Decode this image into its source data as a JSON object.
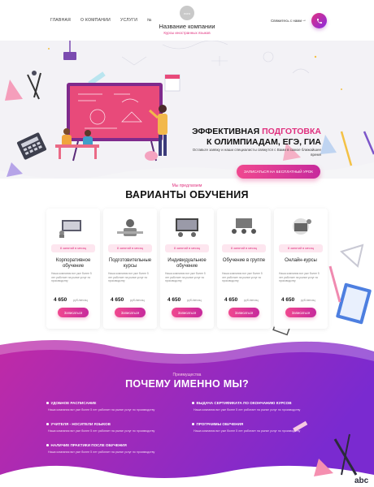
{
  "header": {
    "nav": [
      "Главная",
      "О компании",
      "Услуги",
      "№"
    ],
    "logo_text": "лого",
    "brand_title": "Название компании",
    "brand_subtitle": "Курсы иностранных языков",
    "callback_label": "Свяжитесь с нами",
    "phone_icon": "phone-icon"
  },
  "hero": {
    "title_part1": "ЭФФЕКТИВНАЯ ",
    "title_highlight": "ПОДГОТОВКА",
    "title_part2": "К ОЛИМПИАДАМ, ЕГЭ, ГИА",
    "subtitle": "Оставьте заявку и наши специалисты свяжутся с Вами в самое ближайшее время",
    "cta": "ЗАПИСАТЬСЯ НА БЕСПЛАТНЫЙ УРОК"
  },
  "courses": {
    "kicker": "Мы предлагаем",
    "title": "ВАРИАНТЫ ОБУЧЕНИЯ",
    "items": [
      {
        "badge": "8 занятий в месяц",
        "title": "Корпоративное обучение",
        "desc": "Наша компания вот уже более 5 лет работает на рынке услуг по производству",
        "price": "4 650",
        "unit": "руб./месяц",
        "button": "Записаться"
      },
      {
        "badge": "8 занятий в месяц",
        "title": "Подготовительные курсы",
        "desc": "Наша компания вот уже более 5 лет работает на рынке услуг по производству",
        "price": "4 650",
        "unit": "руб./месяц",
        "button": "Записаться"
      },
      {
        "badge": "8 занятий в месяц",
        "title": "Индивидуальное обучение",
        "desc": "Наша компания вот уже более 5 лет работает на рынке услуг по производству",
        "price": "4 650",
        "unit": "руб./месяц",
        "button": "Записаться"
      },
      {
        "badge": "8 занятий в месяц",
        "title": "Обучение в группе",
        "desc": "Наша компания вот уже более 5 лет работает на рынке услуг по производству",
        "price": "4 650",
        "unit": "руб./месяц",
        "button": "Записаться"
      },
      {
        "badge": "8 занятий в месяц",
        "title": "Онлайн-курсы",
        "desc": "Наша компания вот уже более 5 лет работает на рынке услуг по производству",
        "price": "4 650",
        "unit": "руб./месяц",
        "button": "Записаться"
      }
    ]
  },
  "why": {
    "kicker": "Преимущества",
    "title": "ПОЧЕМУ ИМЕННО МЫ?",
    "features": [
      {
        "title": "Удобное расписание",
        "desc": "Наша компания вот уже более 5 лет работает на рынке услуг по производству"
      },
      {
        "title": "Выдача сертификата по окончанию курсов",
        "desc": "Наша компания вот уже более 5 лет работает на рынке услуг по производству"
      },
      {
        "title": "Учителя - носители языков",
        "desc": "Наша компания вот уже более 5 лет работает на рынке услуг по производству"
      },
      {
        "title": "Программы обучения",
        "desc": "Наша компания вот уже более 5 лет работает на рынке услуг по производству"
      },
      {
        "title": "Наличие практики после обучения",
        "desc": "Наша компания вот уже более 5 лет работает на рынке услуг по производству"
      }
    ]
  },
  "decor": {
    "corner_text": "abc"
  },
  "colors": {
    "accent_pink": "#e0307e",
    "accent_purple": "#8a2be2",
    "why_gradient_start": "#c02aa6",
    "why_gradient_end": "#7a2ad0"
  }
}
